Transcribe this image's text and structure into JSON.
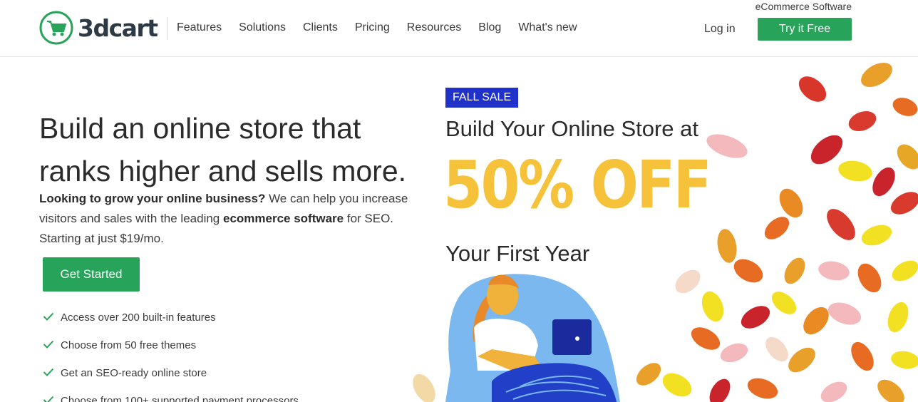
{
  "header": {
    "logo_text": "3dcart",
    "tagline": "eCommerce Software",
    "nav": [
      "Features",
      "Solutions",
      "Clients",
      "Pricing",
      "Resources",
      "Blog",
      "What's new"
    ],
    "login_label": "Log in",
    "try_label": "Try it Free"
  },
  "hero": {
    "headline": "Build an online store that ranks higher and sells more.",
    "intro_bold": "Looking to grow your online business?",
    "intro_text": " We can help you increase visitors and sales with the leading ",
    "intro_bold2": "ecommerce software",
    "intro_text2": " for SEO. Starting at just $19/mo.",
    "cta_label": "Get Started",
    "features": [
      "Access over 200 built-in features",
      "Choose from 50 free themes",
      "Get an SEO-ready online store",
      "Choose from 100+ supported payment processors"
    ]
  },
  "promo": {
    "badge": "FALL SALE",
    "line1": "Build Your Online Store at",
    "big": "50% OFF",
    "line2": "Your First Year"
  },
  "colors": {
    "brand_green": "#27a45a",
    "badge_blue": "#1f31c9",
    "promo_yellow": "#f5c23a"
  }
}
